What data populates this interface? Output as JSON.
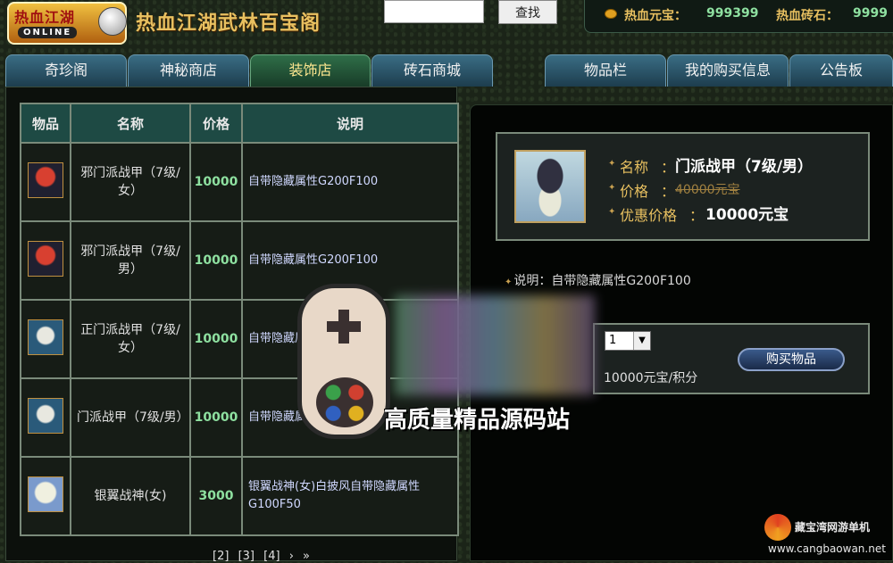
{
  "header": {
    "logo_top": "热血江湖",
    "logo_bottom": "ONLINE",
    "site_title": "热血江湖武林百宝阁",
    "search_placeholder": "",
    "search_button": "查找",
    "yuanbao_label": "热血元宝：",
    "yuanbao_value": "999399",
    "zhuanshi_label": "热血砖石：",
    "zhuanshi_value": "9999"
  },
  "tabs": [
    {
      "label": "奇珍阁",
      "active": false
    },
    {
      "label": "神秘商店",
      "active": false
    },
    {
      "label": "装饰店",
      "active": true
    },
    {
      "label": "砖石商城",
      "active": false
    },
    {
      "label": "物品栏",
      "active": false
    },
    {
      "label": "我的购买信息",
      "active": false
    },
    {
      "label": "公告板",
      "active": false
    }
  ],
  "table": {
    "headers": [
      "物品",
      "名称",
      "价格",
      "说明"
    ],
    "rows": [
      {
        "icon": "armor-icon",
        "name": "邪门派战甲（7级/女）",
        "price": "10000",
        "desc": "自带隐藏属性G200F100"
      },
      {
        "icon": "armor-icon",
        "name": "邪门派战甲（7级/男）",
        "price": "10000",
        "desc": "自带隐藏属性G200F100"
      },
      {
        "icon": "armor-icon",
        "name": "正门派战甲（7级/女）",
        "price": "10000",
        "desc": "自带隐藏属性G200F100"
      },
      {
        "icon": "armor-icon",
        "name": "门派战甲（7级/男）",
        "price": "10000",
        "desc": "自带隐藏属性G200F100"
      },
      {
        "icon": "armor-icon",
        "name": "银翼战神(女)",
        "price": "3000",
        "desc": "银翼战神(女)白披风自带隐藏属性G100F50"
      }
    ]
  },
  "pager": [
    "[2]",
    "[3]",
    "[4]",
    "›",
    "»"
  ],
  "detail": {
    "name_label": "名称",
    "name_value": "门派战甲（7级/男）",
    "price_label": "价格",
    "price_value": "40000元宝",
    "discount_label": "优惠价格",
    "discount_value": "10000元宝",
    "colon": "：",
    "desc_label": "说明：",
    "desc_value": "自带隐藏属性G200F100",
    "qty_value": "1",
    "unit_price": "10000元宝/积分",
    "buy_button": "购买物品"
  },
  "watermark": {
    "text": "高质量精品源码站",
    "corner_top": "藏宝湾网游单机",
    "corner_url": "www.cangbaowan.net"
  }
}
